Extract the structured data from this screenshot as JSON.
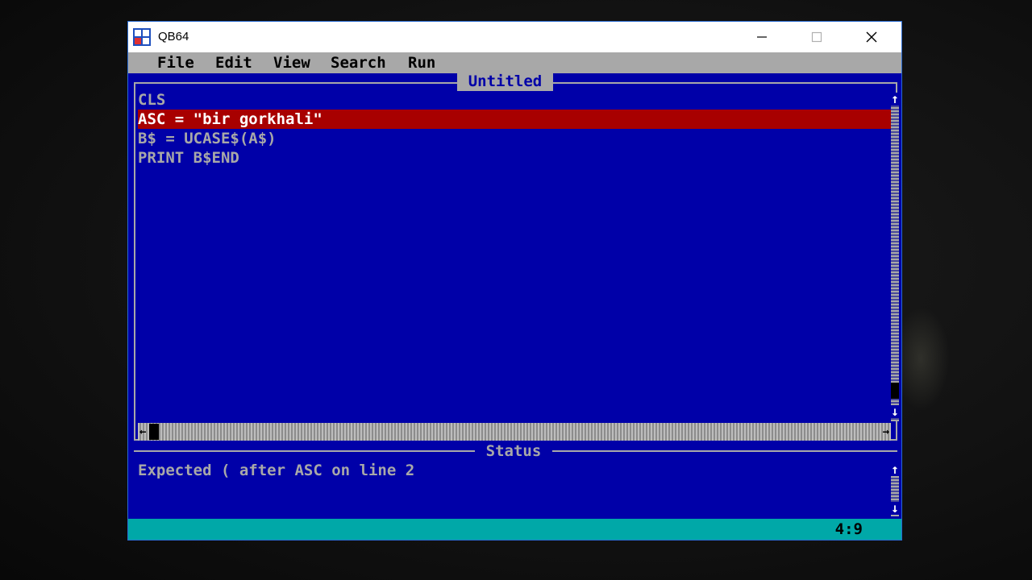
{
  "window": {
    "title": "QB64"
  },
  "menu": [
    {
      "id": "file",
      "label": "File"
    },
    {
      "id": "edit",
      "label": "Edit"
    },
    {
      "id": "view",
      "label": "View"
    },
    {
      "id": "search",
      "label": "Search"
    },
    {
      "id": "run",
      "label": "Run"
    }
  ],
  "editor": {
    "title": "Untitled",
    "lines": [
      "CLS",
      "ASC = \"bir gorkhali\"",
      "B$ = UCASE$(A$)",
      "PRINT B$END"
    ],
    "highlighted_line": 2
  },
  "status": {
    "label": "Status",
    "message": "Expected ( after ASC on line 2"
  },
  "cursor_position": "4:9",
  "icons": {
    "app": "qb64-app-icon",
    "minimize": "minimize-icon",
    "maximize": "maximize-icon",
    "close": "close-icon"
  },
  "colors": {
    "editor_bg": "#0000a8",
    "text": "#a8a8a8",
    "error_highlight": "#a80000",
    "status_bar": "#00a8a8"
  }
}
